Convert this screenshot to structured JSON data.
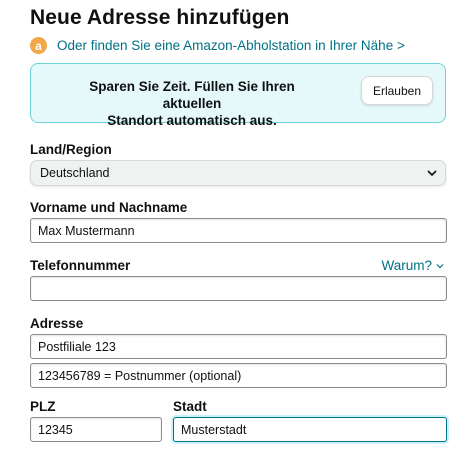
{
  "page": {
    "title": "Neue Adresse hinzufügen",
    "pickup_link": "Oder finden Sie eine Amazon-Abholstation in Ihrer Nähe >",
    "amazon_badge": "a"
  },
  "banner": {
    "text_line1": "Sparen Sie Zeit. Füllen Sie Ihren aktuellen",
    "text_line2": "Standort automatisch aus.",
    "button_label": "Erlauben"
  },
  "form": {
    "country": {
      "label": "Land/Region",
      "value": "Deutschland"
    },
    "name": {
      "label": "Vorname und Nachname",
      "value": "Max Mustermann"
    },
    "phone": {
      "label": "Telefonnummer",
      "value": "",
      "help_link": "Warum?"
    },
    "address": {
      "label": "Adresse",
      "line1_value": "Postfiliale 123",
      "line2_value": "123456789 = Postnummer (optional)"
    },
    "zip": {
      "label": "PLZ",
      "value": "12345"
    },
    "city": {
      "label": "Stadt",
      "value": "Musterstadt"
    }
  },
  "colors": {
    "link": "#007185",
    "banner_bg": "#e6f9fa",
    "banner_border": "#6fd3da",
    "badge": "#f3a847"
  }
}
